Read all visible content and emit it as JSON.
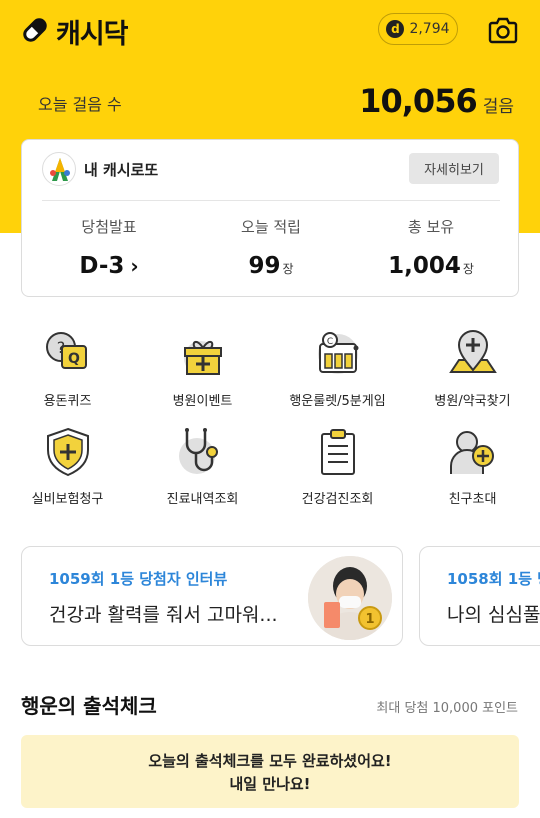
{
  "app": {
    "title": "캐시닥"
  },
  "header": {
    "points": "2,794",
    "coin_glyph": "d",
    "camera_icon": "camera-icon"
  },
  "steps": {
    "label": "오늘 걸음 수",
    "value": "10,056",
    "unit": "걸음"
  },
  "lotto": {
    "title": "내 캐시로또",
    "detail_button": "자세히보기",
    "stats": [
      {
        "label": "당첨발표",
        "value": "D-3",
        "unit": "",
        "chevron": "›"
      },
      {
        "label": "오늘 적립",
        "value": "99",
        "unit": "장"
      },
      {
        "label": "총 보유",
        "value": "1,004",
        "unit": "장"
      }
    ]
  },
  "menu": [
    {
      "label": "용돈퀴즈",
      "icon": "quiz-icon"
    },
    {
      "label": "병원이벤트",
      "icon": "gift-icon"
    },
    {
      "label": "행운룰렛/5분게임",
      "icon": "roulette-icon"
    },
    {
      "label": "병원/약국찾기",
      "icon": "map-pin-icon"
    },
    {
      "label": "실비보험청구",
      "icon": "shield-icon"
    },
    {
      "label": "진료내역조회",
      "icon": "stethoscope-icon"
    },
    {
      "label": "건강검진조회",
      "icon": "clipboard-icon"
    },
    {
      "label": "친구초대",
      "icon": "invite-friend-icon"
    }
  ],
  "banners": [
    {
      "title": "1059회 1등 당첨자 인터뷰",
      "text": "건강과 활력를 줘서 고마워..."
    },
    {
      "title": "1058회 1등 당",
      "text": "나의 심심풀"
    }
  ],
  "attendance": {
    "title": "행운의 출석체크",
    "subtitle": "최대 당첨 10,000 포인트",
    "message_line1": "오늘의 출석체크를 모두 완료하셨어요!",
    "message_line2": "내일 만나요!"
  },
  "colors": {
    "brand": "#ffd20a",
    "accent_blue": "#2d86d9",
    "notice_bg": "#fdf3c9"
  }
}
